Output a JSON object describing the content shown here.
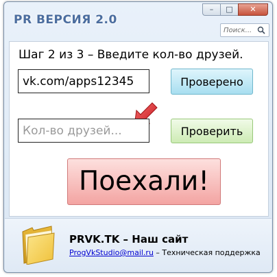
{
  "window": {
    "title": "PR ВЕРСИЯ 2.0",
    "minimize_glyph": "–",
    "maximize_glyph": "□",
    "close_glyph": "✕"
  },
  "search": {
    "placeholder": "Поиск...",
    "value": ""
  },
  "main": {
    "step_label": "Шаг 2 из 3 – Введите кол-во друзей.",
    "url_value": "vk.com/apps12345",
    "verified_button": "Проверено",
    "friends_placeholder": "Кол-во друзей...",
    "friends_value": "",
    "check_button": "Проверить",
    "go_button": "Поехали!"
  },
  "footer": {
    "site_title": "PRVK.TK – Наш сайт",
    "email": "ProgVkStudio@mail.ru",
    "support_text": " – Техническая поддержка"
  },
  "colors": {
    "title": "#4b6d9f",
    "verified_button": "#a8def0",
    "check_button": "#cdebb4",
    "go_button": "#f3a4a2",
    "arrow": "#e0343a",
    "folder": "#f2c94c",
    "link": "#0000d0"
  },
  "icons": {
    "search": "search-icon",
    "arrow": "arrow-down-left-icon",
    "folder": "folder-icon"
  }
}
